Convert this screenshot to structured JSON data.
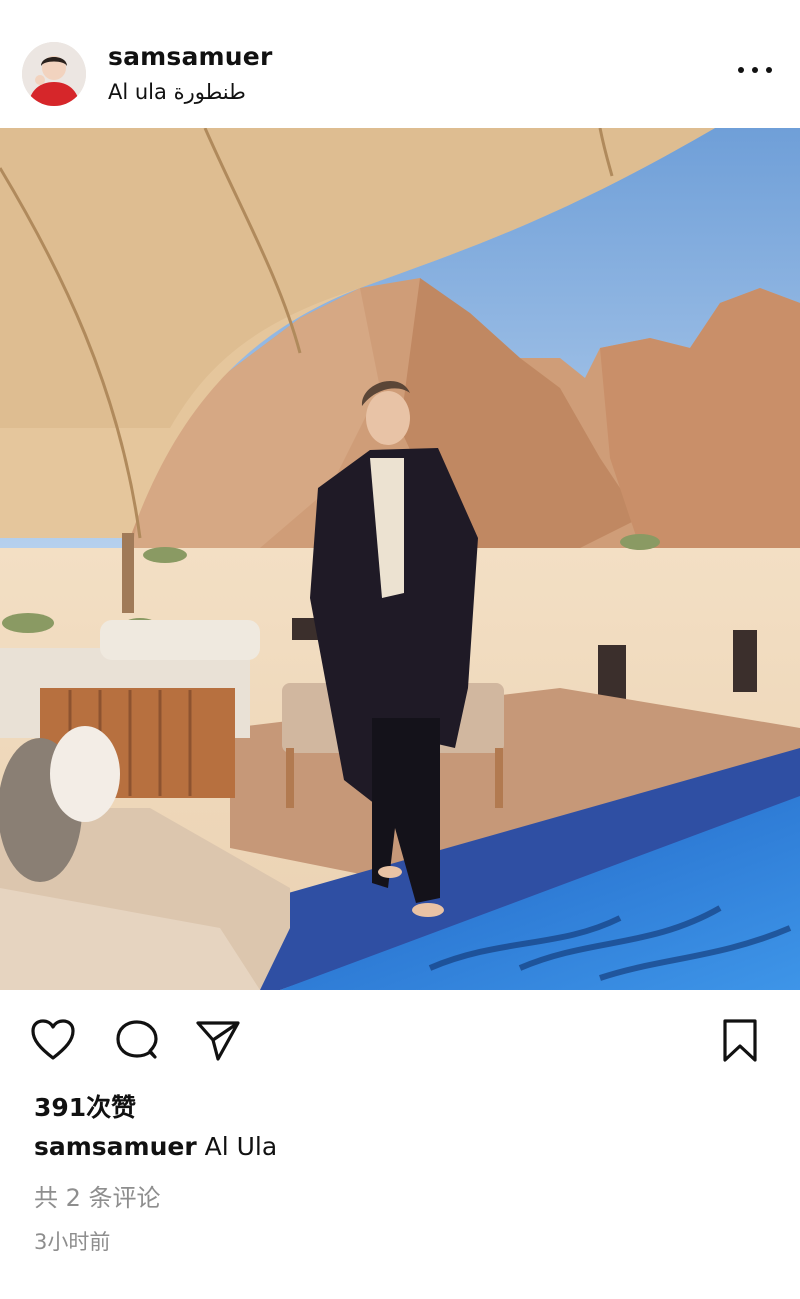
{
  "post": {
    "username": "samsamuer",
    "location": "Al ula  طنطورة",
    "more_icon": "more-horizontal-icon",
    "likes": "391次赞",
    "caption_user": "samsamuer",
    "caption_text": "Al Ula",
    "comments": "共 2 条评论",
    "time": "3小时前"
  },
  "icons": {
    "like": "heart-icon",
    "comment": "comment-icon",
    "share": "send-icon",
    "save": "bookmark-icon"
  }
}
